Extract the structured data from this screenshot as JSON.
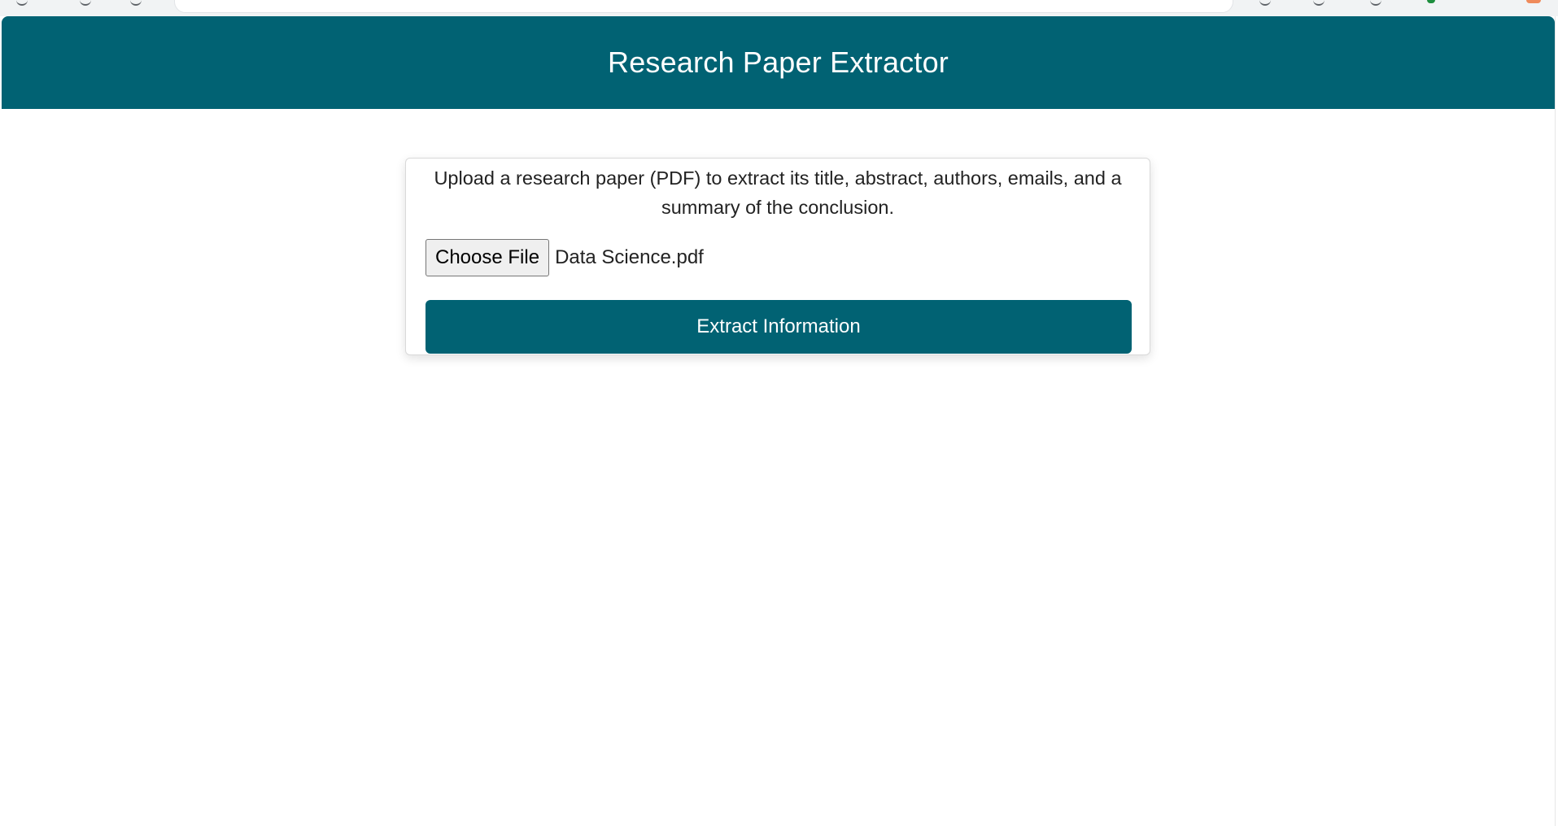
{
  "theme": {
    "brand_color": "#016273",
    "text_on_brand": "#ffffff",
    "body_text": "#222222"
  },
  "header": {
    "title": "Research Paper Extractor"
  },
  "upload_card": {
    "description": "Upload a research paper (PDF) to extract its title, abstract, authors, emails, and a summary of the conclusion.",
    "file_input": {
      "button_label": "Choose File",
      "selected_file": "Data Science.pdf"
    },
    "submit_label": "Extract Information"
  }
}
